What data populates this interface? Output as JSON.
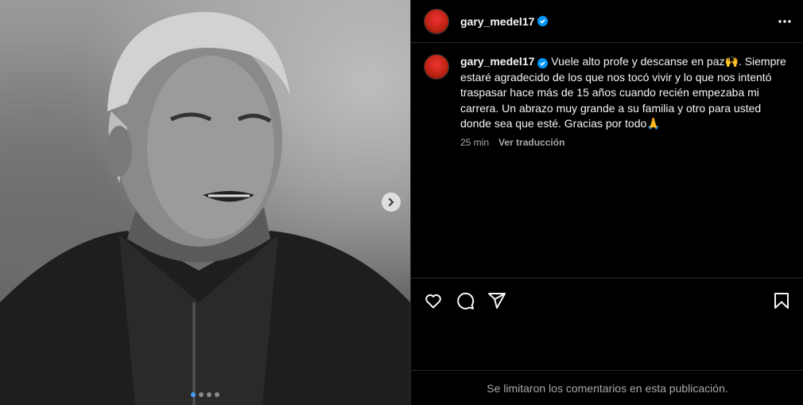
{
  "post": {
    "author": "gary_medel17",
    "caption": "Vuele alto profe y descanse en paz🙌. Siempre estaré agradecido de los que nos tocó vivir y lo que nos intentó traspasar hace más de 15 años cuando recién empezaba mi carrera. Un abrazo muy grande a su familia y otro para usted donde sea que esté. Gracias por todo🙏",
    "time_ago": "25 min",
    "translate_label": "Ver traducción",
    "comments_notice": "Se limitaron los comentarios en esta publicación.",
    "carousel": {
      "total": 4,
      "active_index": 0
    }
  },
  "icons": {
    "verified": "verified-badge-icon",
    "more": "more-options-icon",
    "next": "chevron-right-icon",
    "like": "heart-icon",
    "comment": "comment-icon",
    "share": "paper-plane-icon",
    "save": "bookmark-icon"
  },
  "colors": {
    "verified": "#0095f6",
    "active_dot": "#4a9ff5",
    "background": "#000000",
    "muted_text": "#a8a8a8"
  }
}
